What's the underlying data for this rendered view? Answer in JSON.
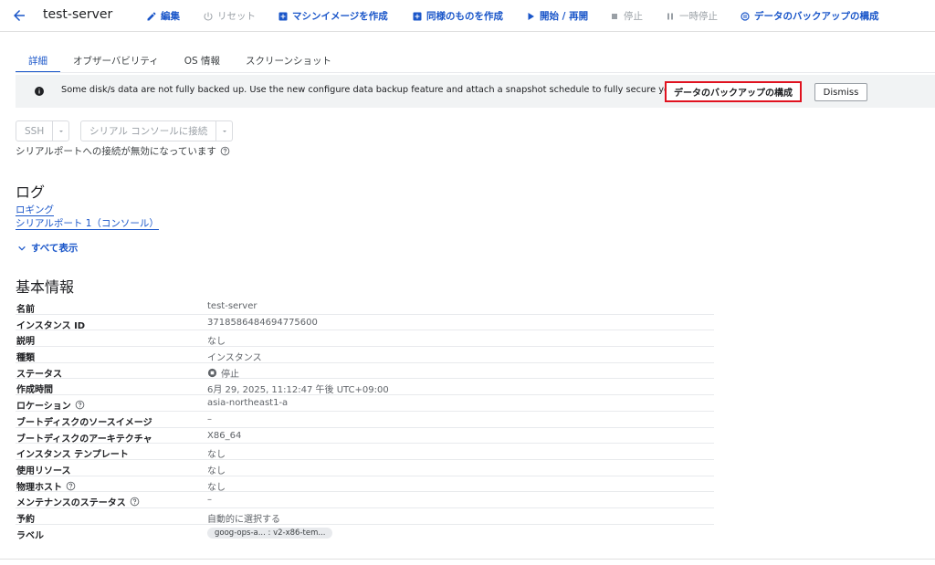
{
  "header": {
    "title": "test-server",
    "actions": [
      {
        "label": "編集",
        "icon": "pencil-icon",
        "enabled": true
      },
      {
        "label": "リセット",
        "icon": "power-icon",
        "enabled": false
      },
      {
        "label": "マシンイメージを作成",
        "icon": "add-box-icon",
        "enabled": true
      },
      {
        "label": "同様のものを作成",
        "icon": "add-box-icon",
        "enabled": true
      },
      {
        "label": "開始 / 再開",
        "icon": "play-icon",
        "enabled": true
      },
      {
        "label": "停止",
        "icon": "stop-icon",
        "enabled": false
      },
      {
        "label": "一時停止",
        "icon": "pause-icon",
        "enabled": false
      },
      {
        "label": "データのバックアップの構成",
        "icon": "backup-icon",
        "enabled": true
      }
    ]
  },
  "tabs": [
    {
      "label": "詳細",
      "active": true
    },
    {
      "label": "オブザーバビリティ",
      "active": false
    },
    {
      "label": "OS 情報",
      "active": false
    },
    {
      "label": "スクリーンショット",
      "active": false
    }
  ],
  "banner": {
    "message": "Some disk/s data are not fully backed up. Use the new configure data backup feature and attach a snapshot schedule to fully secure your data.",
    "primary_label": "データのバックアップの構成",
    "dismiss_label": "Dismiss"
  },
  "connection": {
    "ssh_label": "SSH",
    "serial_label": "シリアル コンソールに接続",
    "serial_note": "シリアルポートへの接続が無効になっています"
  },
  "logs": {
    "heading": "ログ",
    "links": [
      "ロギング",
      "シリアルポート 1（コンソール）"
    ],
    "show_all": "すべて表示"
  },
  "basic_info": {
    "heading": "基本情報",
    "rows": [
      {
        "key": "名前",
        "value": "test-server"
      },
      {
        "key": "インスタンス ID",
        "value": "3718586484694775600"
      },
      {
        "key": "説明",
        "value": "なし"
      },
      {
        "key": "種類",
        "value": "インスタンス"
      },
      {
        "key": "ステータス",
        "value": "停止"
      },
      {
        "key": "作成時間",
        "value": "6月 29, 2025, 11:12:47 午後 UTC+09:00"
      },
      {
        "key": "ロケーション",
        "value": "asia-northeast1-a"
      },
      {
        "key": "ブートディスクのソースイメージ",
        "value": "–"
      },
      {
        "key": "ブートディスクのアーキテクチャ",
        "value": "X86_64"
      },
      {
        "key": "インスタンス テンプレート",
        "value": "なし"
      },
      {
        "key": "使用リソース",
        "value": "なし"
      },
      {
        "key": "物理ホスト",
        "value": "なし"
      },
      {
        "key": "メンテナンスのステータス",
        "value": "–"
      },
      {
        "key": "予約",
        "value": "自動的に選択する"
      },
      {
        "key": "ラベル",
        "value": "goog-ops-a... : v2-x86-tem..."
      }
    ]
  },
  "colors": {
    "accent": "#1a56c9",
    "highlight": "#e0121f",
    "banner_bg": "#f1f3f4"
  }
}
